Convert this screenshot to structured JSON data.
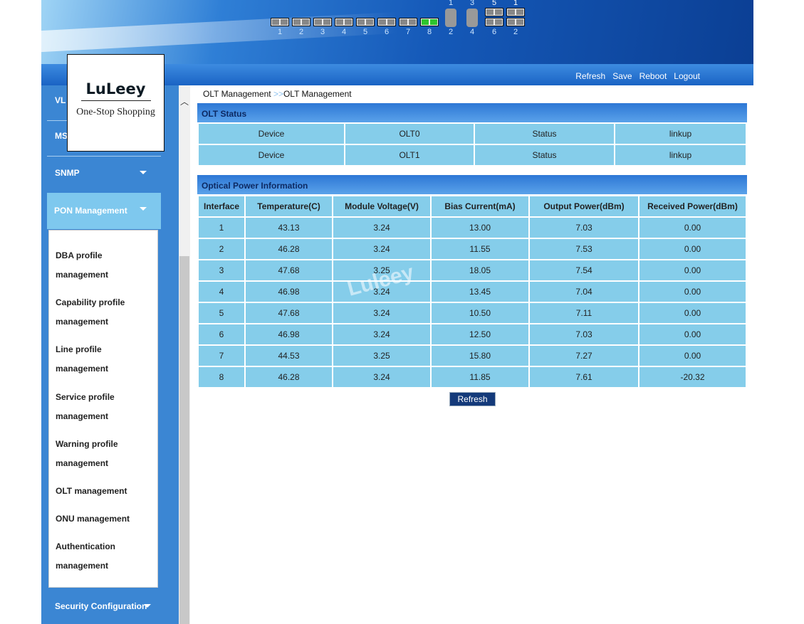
{
  "header": {
    "ports": [
      {
        "label": "1",
        "active": false
      },
      {
        "label": "2",
        "active": false
      },
      {
        "label": "3",
        "active": false
      },
      {
        "label": "4",
        "active": false
      },
      {
        "label": "5",
        "active": false
      },
      {
        "label": "6",
        "active": false
      },
      {
        "label": "7",
        "active": false
      },
      {
        "label": "8",
        "active": true
      }
    ],
    "sfp_ports": [
      {
        "top": "1",
        "bottom": "2"
      },
      {
        "top": "3",
        "bottom": "4"
      }
    ],
    "uplink_ports": [
      {
        "top": "5",
        "bottom": "6"
      },
      {
        "top": "1",
        "bottom": "2"
      }
    ]
  },
  "nav": {
    "links": [
      "Refresh",
      "Save",
      "Reboot",
      "Logout"
    ]
  },
  "logo": {
    "brand": "LuLeey",
    "tagline": "One-Stop Shopping"
  },
  "sidebar": {
    "items": [
      "VL",
      "MS",
      "SNMP"
    ],
    "active": "PON Management",
    "submenu": [
      [
        "DBA profile",
        "management"
      ],
      [
        "Capability profile",
        "management"
      ],
      [
        "Line profile",
        "management"
      ],
      [
        "Service profile",
        "management"
      ],
      [
        "Warning profile",
        "management"
      ],
      [
        "OLT management"
      ],
      [
        "ONU management"
      ],
      [
        "Authentication",
        "management"
      ]
    ],
    "bottom": "Security Configuration"
  },
  "breadcrumb": {
    "parent": "OLT Management",
    "sep": ">>",
    "current": "OLT Management"
  },
  "olt_status": {
    "title": "OLT Status",
    "rows": [
      [
        "Device",
        "OLT0",
        "Status",
        "linkup"
      ],
      [
        "Device",
        "OLT1",
        "Status",
        "linkup"
      ]
    ]
  },
  "optical": {
    "title": "Optical Power Information",
    "headers": [
      "Interface",
      "Temperature(C)",
      "Module Voltage(V)",
      "Bias Current(mA)",
      "Output Power(dBm)",
      "Received Power(dBm)"
    ],
    "rows": [
      [
        "1",
        "43.13",
        "3.24",
        "13.00",
        "7.03",
        "0.00"
      ],
      [
        "2",
        "46.28",
        "3.24",
        "11.55",
        "7.53",
        "0.00"
      ],
      [
        "3",
        "47.68",
        "3.25",
        "18.05",
        "7.54",
        "0.00"
      ],
      [
        "4",
        "46.98",
        "3.24",
        "13.45",
        "7.04",
        "0.00"
      ],
      [
        "5",
        "47.68",
        "3.24",
        "10.50",
        "7.11",
        "0.00"
      ],
      [
        "6",
        "46.98",
        "3.24",
        "12.50",
        "7.03",
        "0.00"
      ],
      [
        "7",
        "44.53",
        "3.25",
        "15.80",
        "7.27",
        "0.00"
      ],
      [
        "8",
        "46.28",
        "3.24",
        "11.85",
        "7.61",
        "-20.32"
      ]
    ]
  },
  "watermark": "Luleey",
  "refresh_label": "Refresh"
}
